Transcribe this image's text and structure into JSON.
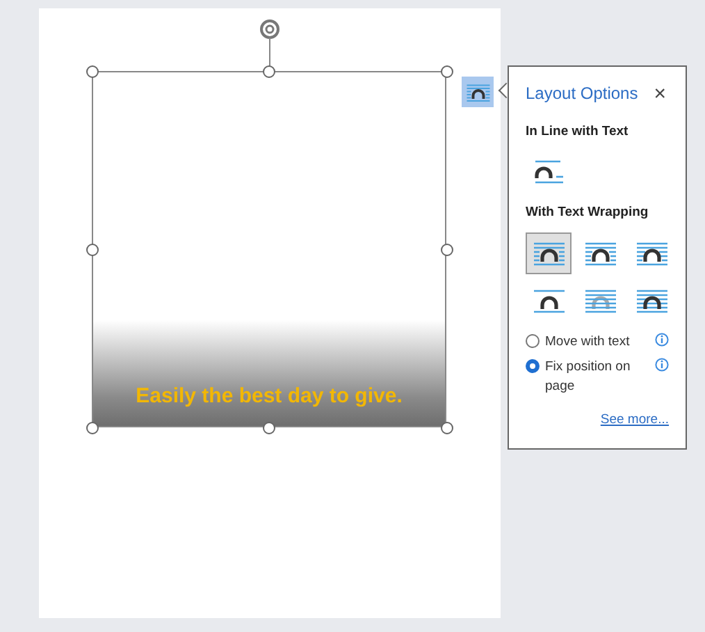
{
  "image": {
    "caption": "Easily the best day to give.",
    "selected": true
  },
  "layout_options": {
    "title": "Layout Options",
    "close": "×",
    "sections": [
      {
        "heading": "In Line with Text",
        "options": [
          {
            "kind": "inline",
            "selected": false
          }
        ]
      },
      {
        "heading": "With Text Wrapping",
        "options": [
          {
            "kind": "square",
            "selected": true
          },
          {
            "kind": "tight",
            "selected": false
          },
          {
            "kind": "through",
            "selected": false
          },
          {
            "kind": "topbottom",
            "selected": false
          },
          {
            "kind": "behind",
            "selected": false
          },
          {
            "kind": "front",
            "selected": false
          }
        ]
      }
    ],
    "position": [
      {
        "label": "Move with text",
        "selected": false
      },
      {
        "label": "Fix position on page",
        "selected": true
      }
    ],
    "link": "See more..."
  }
}
